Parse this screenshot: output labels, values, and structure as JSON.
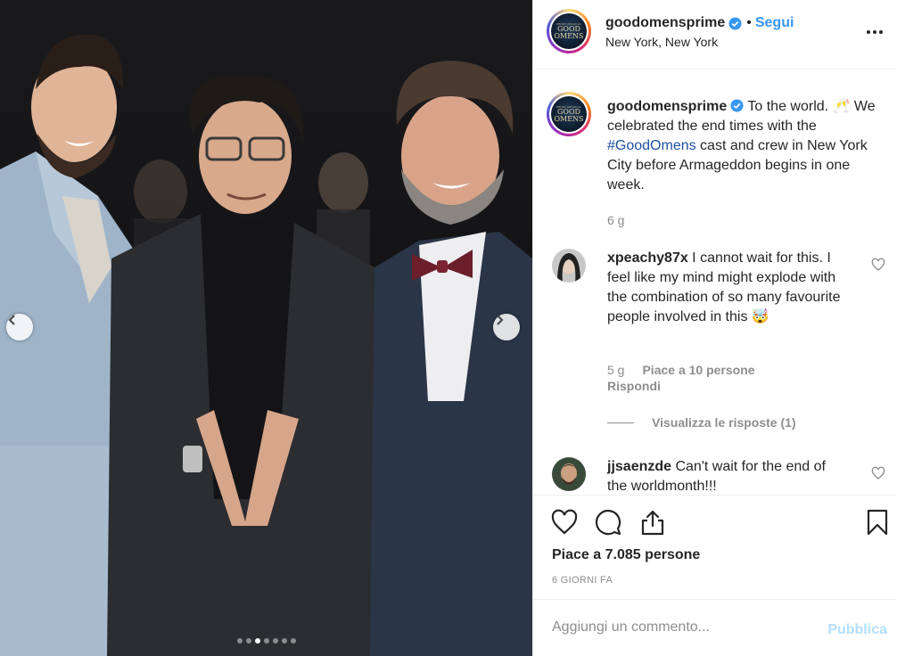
{
  "post": {
    "username": "goodomensprime",
    "follow_separator": "•",
    "follow_label": "Segui",
    "location": "New York, New York",
    "avatar_logo_lines": [
      "GOOD",
      "OMENS"
    ],
    "avatar_logo_small": "PRIME ORIGINAL",
    "caption_text_before_hashtag": " To the world. 🥂 We celebrated the end times with the ",
    "caption_hashtag": "#GoodOmens",
    "caption_text_after_hashtag": " cast and crew in New York City before Armageddon begins in one week.",
    "caption_time": "6 g"
  },
  "comments": [
    {
      "username": "xpeachy87x",
      "text": " I cannot wait for this. I feel like my mind might explode with the combination of so many favourite people involved in this 🤯",
      "time": "5 g",
      "likes": "Piace a 10 persone",
      "reply_label": "Rispondi",
      "view_replies": "Visualizza le risposte (1)"
    },
    {
      "username": "jjsaenzde",
      "text": " Can't wait for the end of the worldmonth!!!"
    }
  ],
  "actions": {
    "likes_text": "Piace a 7.085 persone",
    "time_ago": "6 GIORNI FA"
  },
  "composer": {
    "placeholder": "Aggiungi un commento...",
    "publish_label": "Pubblica"
  },
  "carousel": {
    "total_slides": 7,
    "active_index": 2
  },
  "colors": {
    "link_blue": "#3897f0",
    "muted": "#8e8e8e",
    "publish_disabled": "#b2dffc"
  }
}
